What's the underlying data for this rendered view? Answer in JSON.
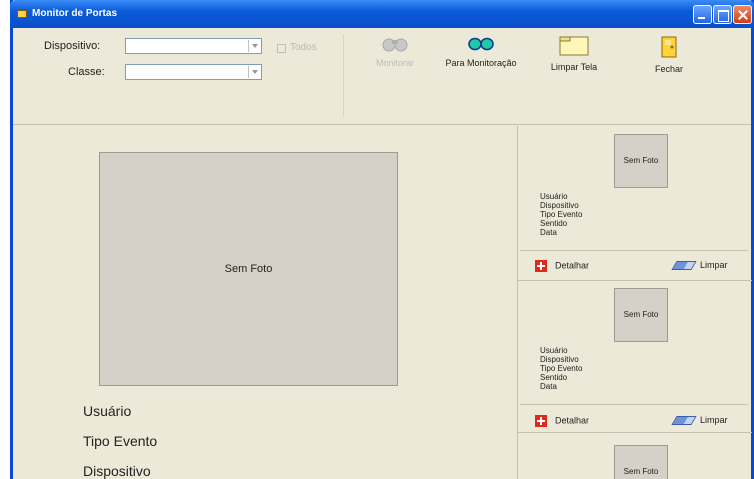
{
  "window": {
    "title": "Monitor de Portas"
  },
  "filters": {
    "device_label": "Dispositivo:",
    "device_value": "",
    "all_label": "Todos",
    "class_label": "Classe:",
    "class_value": ""
  },
  "toolbar": {
    "monitor_label": "Monitorar",
    "stop_label": "Para Monitoração",
    "clear_label": "Limpar Tela",
    "close_label": "Fechar"
  },
  "main": {
    "no_photo": "Sem Foto",
    "user_label": "Usuário",
    "event_type_label": "Tipo Evento",
    "device_label": "Dispositivo"
  },
  "cards": [
    {
      "no_photo": "Sem Foto",
      "user": "Usuário",
      "device": "Dispositivo",
      "event_type": "Tipo Evento",
      "direction": "Sentido",
      "date": "Data",
      "detail_label": "Detalhar",
      "clear_label": "Limpar"
    },
    {
      "no_photo": "Sem Foto",
      "user": "Usuário",
      "device": "Dispositivo",
      "event_type": "Tipo Evento",
      "direction": "Sentido",
      "date": "Data",
      "detail_label": "Detalhar",
      "clear_label": "Limpar"
    },
    {
      "no_photo": "Sem Foto"
    }
  ],
  "colors": {
    "titlebar": "#0a4fc8",
    "window_bg": "#ece9d8",
    "photo_bg": "#d5d0c8",
    "detail_icon": "#e0281c",
    "clear_icon": "#6f93d8"
  }
}
